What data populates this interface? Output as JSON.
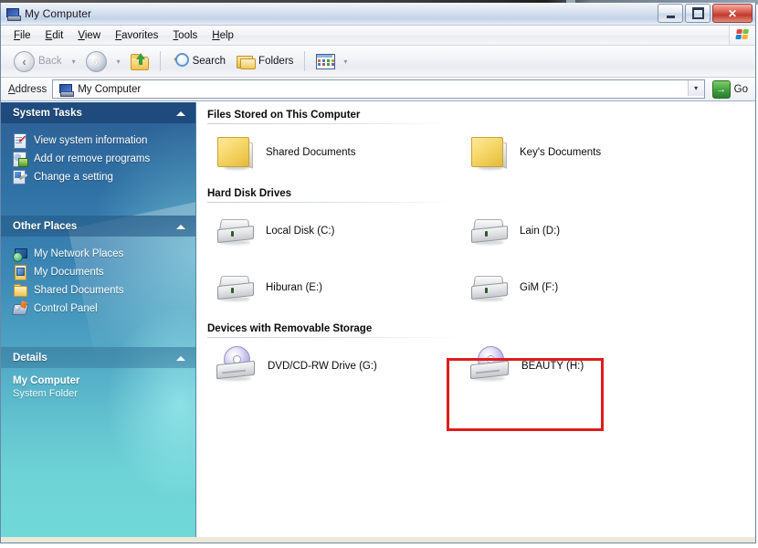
{
  "window": {
    "title": "My Computer",
    "title_icon": "my-computer-icon",
    "buttons": {
      "minimize": "minimize-button",
      "maximize": "maximize-button",
      "close": "close-button",
      "close_glyph": "✕"
    }
  },
  "menu": {
    "items": [
      {
        "label": "File",
        "accel": "F",
        "rest": "ile"
      },
      {
        "label": "Edit",
        "accel": "E",
        "rest": "dit"
      },
      {
        "label": "View",
        "accel": "V",
        "rest": "iew"
      },
      {
        "label": "Favorites",
        "accel": "F",
        "rest": "avorites"
      },
      {
        "label": "Tools",
        "accel": "T",
        "rest": "ools"
      },
      {
        "label": "Help",
        "accel": "H",
        "rest": "elp"
      }
    ],
    "brand_icon": "windows-flag-icon"
  },
  "toolbar": {
    "back_label": "Back",
    "back_icon": "back-arrow-icon",
    "back_enabled": false,
    "forward_icon": "forward-arrow-icon",
    "up_icon": "up-one-level-icon",
    "search_label": "Search",
    "search_icon": "magnifier-icon",
    "folders_label": "Folders",
    "folders_icon": "folders-icon",
    "views_icon": "views-icon",
    "dropdown_caret": "▾"
  },
  "address": {
    "label": "Address",
    "accel_prefix": "A",
    "accel_rest": "ddress",
    "value": "My Computer",
    "icon": "my-computer-icon",
    "dropdown_caret": "▾",
    "go_label": "Go",
    "go_icon": "go-arrow-icon",
    "go_glyph": "→"
  },
  "sidebar": {
    "panels": [
      {
        "title": "System Tasks",
        "collapse_icon": "chevron-up-icon",
        "items": [
          {
            "label": "View system information",
            "icon": "system-information-icon"
          },
          {
            "label": "Add or remove programs",
            "icon": "add-remove-programs-icon"
          },
          {
            "label": "Change a setting",
            "icon": "change-setting-icon"
          }
        ]
      },
      {
        "title": "Other Places",
        "collapse_icon": "chevron-up-icon",
        "items": [
          {
            "label": "My Network Places",
            "icon": "network-places-icon"
          },
          {
            "label": "My Documents",
            "icon": "my-documents-icon"
          },
          {
            "label": "Shared Documents",
            "icon": "shared-documents-folder-icon"
          },
          {
            "label": "Control Panel",
            "icon": "control-panel-icon"
          }
        ]
      }
    ],
    "details": {
      "title": "Details",
      "collapse_icon": "chevron-up-icon",
      "name": "My Computer",
      "type": "System Folder"
    }
  },
  "main": {
    "groups": [
      {
        "heading": "Files Stored on This Computer",
        "items": [
          {
            "label": "Shared Documents",
            "icon": "folder-icon",
            "highlighted": false
          },
          {
            "label": "Key's Documents",
            "icon": "folder-icon",
            "highlighted": false
          }
        ]
      },
      {
        "heading": "Hard Disk Drives",
        "items": [
          {
            "label": "Local Disk (C:)",
            "icon": "hard-drive-icon",
            "highlighted": false
          },
          {
            "label": "Lain (D:)",
            "icon": "hard-drive-icon",
            "highlighted": false
          },
          {
            "label": "Hiburan (E:)",
            "icon": "hard-drive-icon",
            "highlighted": false
          },
          {
            "label": "GiM (F:)",
            "icon": "hard-drive-icon",
            "highlighted": false
          }
        ]
      },
      {
        "heading": "Devices with Removable Storage",
        "items": [
          {
            "label": "DVD/CD-RW Drive (G:)",
            "icon": "optical-drive-icon",
            "highlighted": false
          },
          {
            "label": "BEAUTY (H:)",
            "icon": "optical-drive-icon",
            "highlighted": true
          }
        ]
      }
    ]
  },
  "annotation": {
    "target": "BEAUTY (H:)",
    "color": "#e01b1b"
  },
  "colors": {
    "sidebar_top": "#2d5f94",
    "sidebar_bottom": "#71d8d8",
    "titlebar": "#d3def0",
    "close_button": "#c03b2c",
    "annotation_red": "#e01b1b"
  }
}
